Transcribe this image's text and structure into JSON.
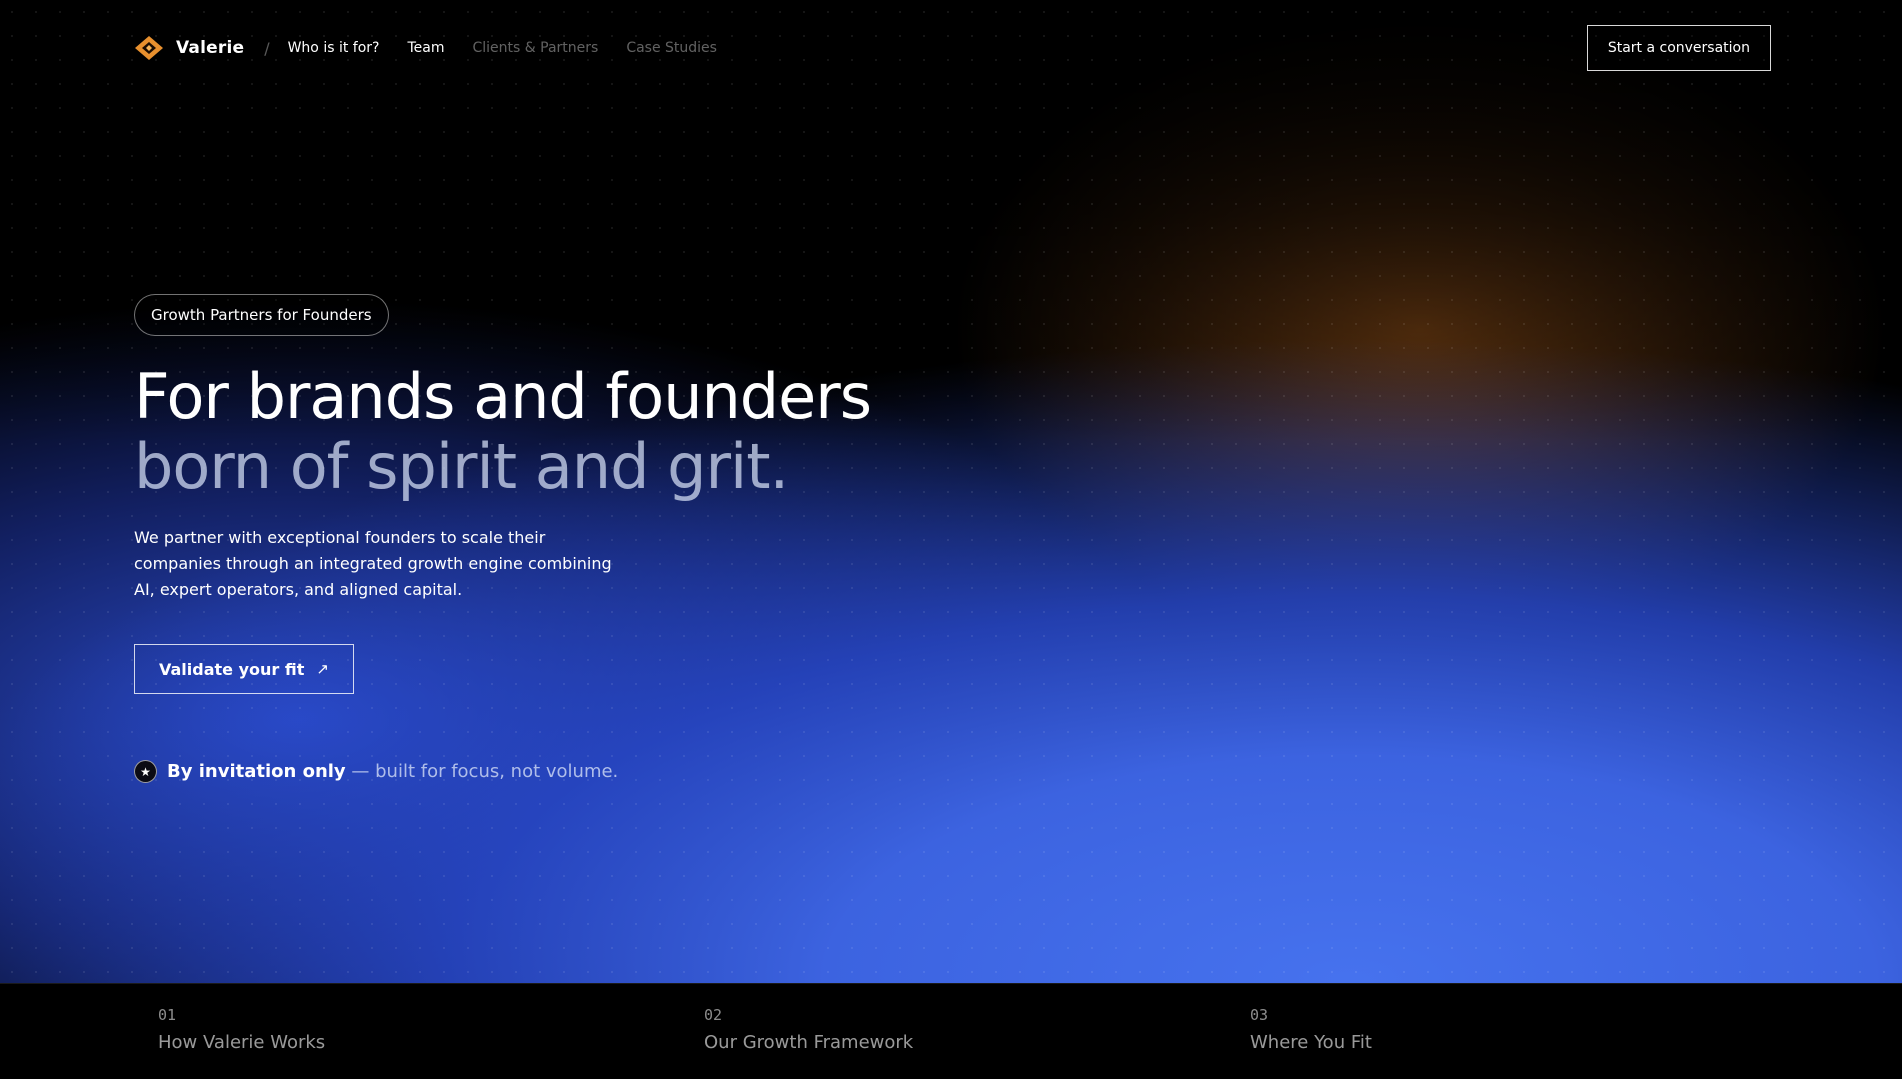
{
  "brand": {
    "name": "Valerie",
    "logo": "diamond-logo-icon",
    "accent": "#f0a040"
  },
  "nav": {
    "separator": "/",
    "links": [
      "Who is it for?",
      "Team",
      "Clients & Partners",
      "Case Studies"
    ],
    "cta": "Start a conversation"
  },
  "hero": {
    "pill": "Growth Partners for Founders",
    "headline_1": "For brands and founders",
    "headline_2": "born of spirit and grit.",
    "lede": "We partner with exceptional founders to scale their companies through an integrated growth engine combining AI, expert operators, and aligned capital.",
    "button": "Validate your fit",
    "button_icon": "↗",
    "invite_strong": "By invitation only",
    "invite_rest": " — built for focus, not volume."
  },
  "footer": {
    "items": [
      {
        "num": "01",
        "title": "How Valerie Works"
      },
      {
        "num": "02",
        "title": "Our Growth Framework"
      },
      {
        "num": "03",
        "title": "Where You Fit"
      }
    ]
  },
  "colors": {
    "blue": "#4672ee",
    "amber": "#78421a",
    "background": "#000000"
  }
}
